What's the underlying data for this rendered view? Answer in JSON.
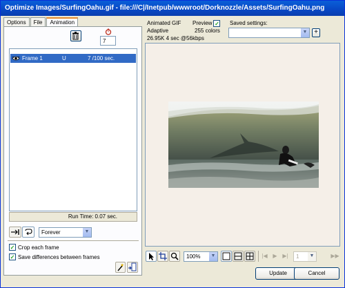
{
  "window": {
    "title": "Optimize Images/SurfingOahu.gif - file:///C|/Inetpub/wwwroot/Dorknozzle/Assets/SurfingOahu.png"
  },
  "tabs": [
    {
      "label": "Options",
      "active": false
    },
    {
      "label": "File",
      "active": false
    },
    {
      "label": "Animation",
      "active": true
    }
  ],
  "animation": {
    "frame_delay_value": "7",
    "frames": [
      {
        "name": "Frame 1",
        "disposal": "U",
        "delay": "7 /100 sec."
      }
    ],
    "run_time": "Run Time: 0.07 sec.",
    "loop_option": "Forever",
    "crop_each_frame": {
      "label": "Crop each frame",
      "checked": true
    },
    "save_differences": {
      "label": "Save differences between frames",
      "checked": true
    }
  },
  "info": {
    "format": "Animated GIF",
    "palette": "Adaptive",
    "size_time": "26.95K  4 sec @56kbps",
    "preview_label": "Preview",
    "preview_checked": true,
    "colors": "255 colors"
  },
  "saved_settings": {
    "label": "Saved settings:",
    "value": ""
  },
  "toolbar": {
    "zoom": "100%",
    "frame_value": "1"
  },
  "buttons": {
    "update": "Update",
    "cancel": "Cancel"
  },
  "colors": {
    "title_bar": "#0847c4",
    "selection": "#316ac5",
    "dialog_bg": "#ece9d8",
    "preview_bg": "#f5efe8"
  }
}
